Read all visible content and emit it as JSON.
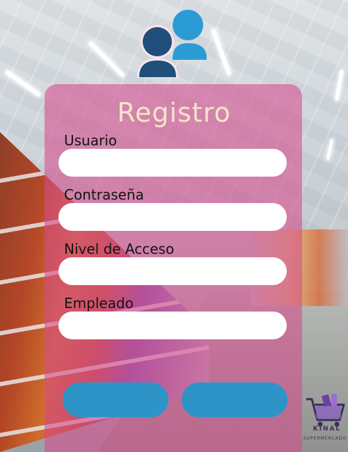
{
  "form": {
    "title": "Registro",
    "fields": [
      {
        "label": "Usuario",
        "value": ""
      },
      {
        "label": "Contraseña",
        "value": ""
      },
      {
        "label": "Nivel de Acceso",
        "value": ""
      },
      {
        "label": "Empleado",
        "value": ""
      }
    ],
    "buttons": [
      {
        "label": ""
      },
      {
        "label": ""
      }
    ]
  },
  "logo": {
    "name": "KINAL",
    "subtitle": "SUPERMERCADO"
  },
  "colors": {
    "card": "#d64a8c",
    "title": "#f6e3c8",
    "button": "#2e94c8",
    "icon_dark": "#1f4f7a",
    "icon_light": "#2b9bd6"
  },
  "icons": {
    "header": "users-icon",
    "logo": "shopping-cart-icon"
  }
}
